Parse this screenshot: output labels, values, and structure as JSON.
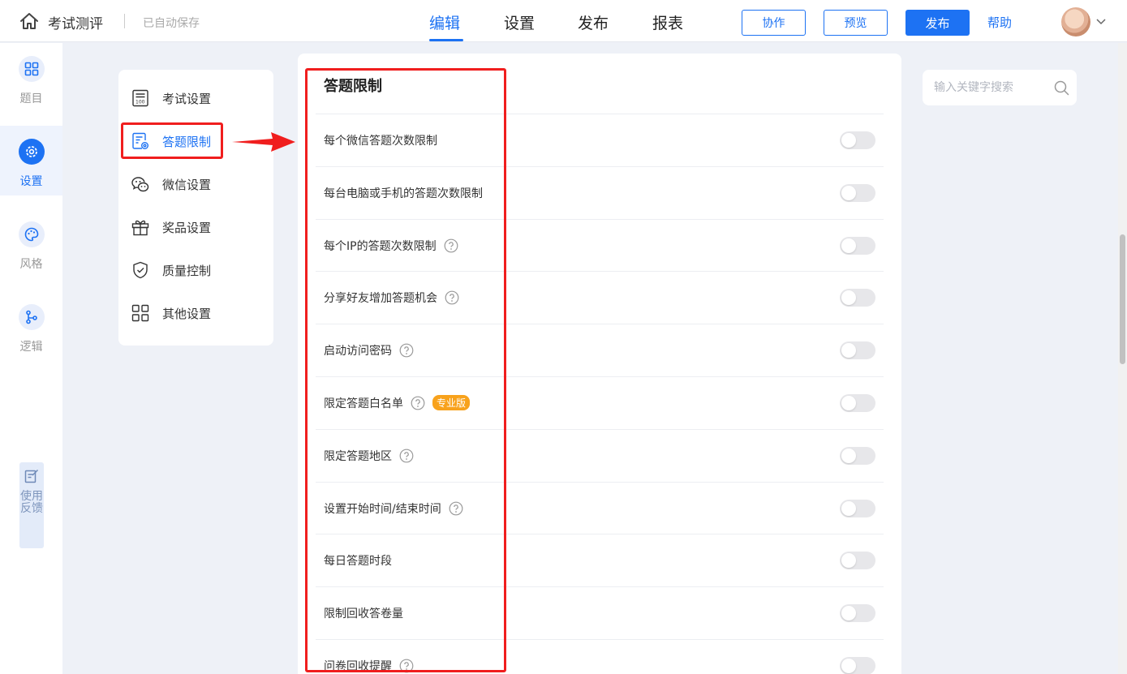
{
  "header": {
    "app_title": "考试测评",
    "save_status": "已自动保存",
    "tabs": [
      {
        "label": "编辑",
        "active": true
      },
      {
        "label": "设置",
        "active": false
      },
      {
        "label": "发布",
        "active": false
      },
      {
        "label": "报表",
        "active": false
      }
    ],
    "collab_label": "协作",
    "preview_label": "预览",
    "publish_label": "发布",
    "help_label": "帮助"
  },
  "rail": {
    "items": [
      {
        "label": "题目",
        "icon": "grid-icon",
        "active": false
      },
      {
        "label": "设置",
        "icon": "gear-icon",
        "active": true
      },
      {
        "label": "风格",
        "icon": "palette-icon",
        "active": false
      },
      {
        "label": "逻辑",
        "icon": "logic-branch-icon",
        "active": false
      }
    ],
    "feedback_label": "使用反馈"
  },
  "menu": {
    "items": [
      {
        "label": "考试设置",
        "icon": "exam-sheet-icon",
        "active": false
      },
      {
        "label": "答题限制",
        "icon": "answer-limit-icon",
        "active": true
      },
      {
        "label": "微信设置",
        "icon": "wechat-icon",
        "active": false
      },
      {
        "label": "奖品设置",
        "icon": "gift-icon",
        "active": false
      },
      {
        "label": "质量控制",
        "icon": "shield-check-icon",
        "active": false
      },
      {
        "label": "其他设置",
        "icon": "apps-icon",
        "active": false
      }
    ]
  },
  "panel": {
    "title": "答题限制",
    "rows": [
      {
        "label": "每个微信答题次数限制",
        "help": false,
        "badge": null,
        "enabled": false
      },
      {
        "label": "每台电脑或手机的答题次数限制",
        "help": false,
        "badge": null,
        "enabled": false
      },
      {
        "label": "每个IP的答题次数限制",
        "help": true,
        "badge": null,
        "enabled": false
      },
      {
        "label": "分享好友增加答题机会",
        "help": true,
        "badge": null,
        "enabled": false
      },
      {
        "label": "启动访问密码",
        "help": true,
        "badge": null,
        "enabled": false
      },
      {
        "label": "限定答题白名单",
        "help": true,
        "badge": "专业版",
        "enabled": false
      },
      {
        "label": "限定答题地区",
        "help": true,
        "badge": null,
        "enabled": false
      },
      {
        "label": "设置开始时间/结束时间",
        "help": true,
        "badge": null,
        "enabled": false
      },
      {
        "label": "每日答题时段",
        "help": false,
        "badge": null,
        "enabled": false
      },
      {
        "label": "限制回收答卷量",
        "help": false,
        "badge": null,
        "enabled": false
      },
      {
        "label": "问卷回收提醒",
        "help": true,
        "badge": null,
        "enabled": false
      }
    ]
  },
  "search": {
    "placeholder": "输入关键字搜索",
    "value": ""
  },
  "colors": {
    "accent": "#1d72f3",
    "annotation_red": "#f01e1e",
    "pro_badge": "#f8a21c"
  }
}
